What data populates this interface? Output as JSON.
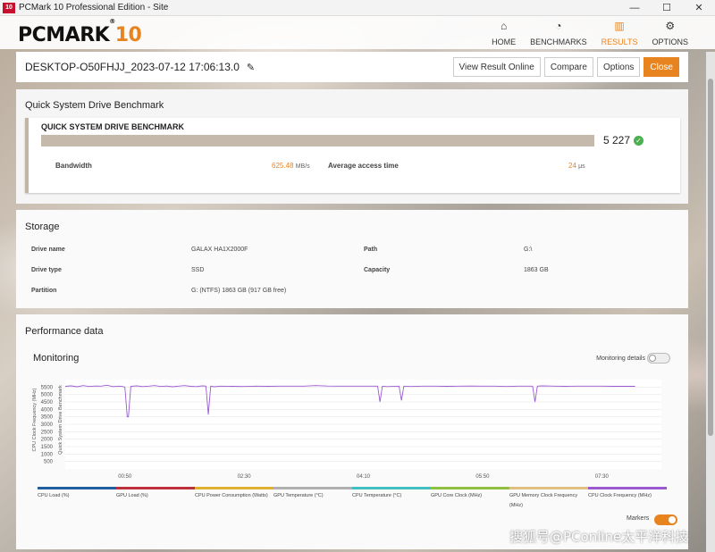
{
  "window": {
    "title": "PCMark 10 Professional Edition - Site",
    "app_icon": "10",
    "controls": [
      "—",
      "☐",
      "✕"
    ]
  },
  "header": {
    "logo_main": "PCMARK",
    "logo_num": "10",
    "logo_reg": "®",
    "nav": [
      {
        "label": "HOME",
        "icon": "home-icon",
        "glyph": "⌂",
        "active": false
      },
      {
        "label": "BENCHMARKS",
        "icon": "gauge-icon",
        "glyph": "◔",
        "active": false
      },
      {
        "label": "RESULTS",
        "icon": "bar-chart-icon",
        "glyph": "▥",
        "active": true
      },
      {
        "label": "OPTIONS",
        "icon": "gear-icon",
        "glyph": "⚙",
        "active": false
      }
    ]
  },
  "result": {
    "name": "DESKTOP-O50FHJJ_2023-07-12 17:06:13.0",
    "edit_icon": "pencil-icon",
    "buttons": {
      "view_online": "View Result Online",
      "compare": "Compare",
      "options": "Options",
      "close": "Close"
    }
  },
  "benchmark": {
    "section_title": "Quick System Drive Benchmark",
    "card_title": "QUICK SYSTEM DRIVE BENCHMARK",
    "score": "5 227",
    "bandwidth_label": "Bandwidth",
    "bandwidth_value": "625.48",
    "bandwidth_unit": "MB/s",
    "access_label": "Average access time",
    "access_value": "24",
    "access_unit": "μs"
  },
  "storage": {
    "section_title": "Storage",
    "drive_name_label": "Drive name",
    "drive_name": "GALAX HA1X2000F",
    "drive_type_label": "Drive type",
    "drive_type": "SSD",
    "partition_label": "Partition",
    "partition": "G: (NTFS) 1863 GB (917 GB free)",
    "path_label": "Path",
    "path": "G:\\",
    "capacity_label": "Capacity",
    "capacity": "1863 GB"
  },
  "performance": {
    "section_title": "Performance data",
    "monitoring_title": "Monitoring",
    "monitoring_details_label": "Monitoring details",
    "monitoring_details_on": false,
    "markers_label": "Markers",
    "markers_on": true
  },
  "chart_data": {
    "type": "line",
    "ylabel_outer": "CPU Clock Frequency (MHz)",
    "ylabel_inner": "Quick System Drive Benchmark",
    "y_ticks": [
      500,
      1000,
      1500,
      2000,
      2500,
      3000,
      3500,
      4000,
      4500,
      5000,
      5500
    ],
    "ylim": [
      0,
      6000
    ],
    "x_ticks": [
      "00:50",
      "02:30",
      "04:10",
      "05:50",
      "07:30"
    ],
    "x_tick_seconds": [
      50,
      150,
      250,
      350,
      450
    ],
    "xlim": [
      0,
      500
    ],
    "series": [
      {
        "name": "CPU Clock Frequency (MHz)",
        "color": "#9b59d0",
        "points": [
          [
            0,
            5550
          ],
          [
            5,
            5580
          ],
          [
            10,
            5520
          ],
          [
            15,
            5600
          ],
          [
            20,
            5540
          ],
          [
            25,
            5570
          ],
          [
            30,
            5560
          ],
          [
            35,
            5620
          ],
          [
            40,
            5530
          ],
          [
            45,
            5560
          ],
          [
            48,
            5540
          ],
          [
            50,
            5500
          ],
          [
            52,
            3500
          ],
          [
            53,
            3500
          ],
          [
            55,
            5550
          ],
          [
            60,
            5580
          ],
          [
            65,
            5530
          ],
          [
            70,
            5560
          ],
          [
            75,
            5600
          ],
          [
            80,
            5540
          ],
          [
            85,
            5570
          ],
          [
            90,
            5520
          ],
          [
            95,
            5560
          ],
          [
            100,
            5600
          ],
          [
            105,
            5550
          ],
          [
            110,
            5530
          ],
          [
            115,
            5580
          ],
          [
            118,
            5560
          ],
          [
            120,
            3650
          ],
          [
            122,
            5560
          ],
          [
            125,
            5520
          ],
          [
            130,
            5560
          ],
          [
            140,
            5550
          ],
          [
            150,
            5540
          ],
          [
            160,
            5560
          ],
          [
            170,
            5550
          ],
          [
            180,
            5560
          ],
          [
            190,
            5560
          ],
          [
            200,
            5560
          ],
          [
            210,
            5600
          ],
          [
            220,
            5570
          ],
          [
            230,
            5560
          ],
          [
            240,
            5560
          ],
          [
            250,
            5560
          ],
          [
            262,
            5560
          ],
          [
            264,
            4500
          ],
          [
            266,
            5560
          ],
          [
            270,
            5530
          ],
          [
            280,
            5560
          ],
          [
            282,
            4600
          ],
          [
            284,
            5560
          ],
          [
            290,
            5540
          ],
          [
            300,
            5560
          ],
          [
            310,
            5560
          ],
          [
            320,
            5550
          ],
          [
            330,
            5560
          ],
          [
            340,
            5570
          ],
          [
            350,
            5560
          ],
          [
            360,
            5560
          ],
          [
            370,
            5540
          ],
          [
            380,
            5560
          ],
          [
            392,
            5560
          ],
          [
            394,
            4500
          ],
          [
            396,
            5560
          ],
          [
            400,
            5580
          ],
          [
            410,
            5560
          ],
          [
            420,
            5550
          ],
          [
            430,
            5560
          ],
          [
            440,
            5560
          ],
          [
            450,
            5560
          ],
          [
            460,
            5550
          ],
          [
            470,
            5550
          ],
          [
            478,
            5550
          ]
        ]
      }
    ],
    "legend": [
      {
        "name": "CPU Load (%)",
        "color": "#1f5fa0"
      },
      {
        "name": "GPU Load (%)",
        "color": "#c0303a"
      },
      {
        "name": "CPU Power Consumption (Watts)",
        "color": "#e0b030"
      },
      {
        "name": "GPU Temperature (°C)",
        "color": "#b0b0b0"
      },
      {
        "name": "CPU Temperature (°C)",
        "color": "#40c0c0"
      },
      {
        "name": "GPU Core Clock (MHz)",
        "color": "#90c040"
      },
      {
        "name": "GPU Memory Clock Frequency (MHz)",
        "color": "#e0c080"
      },
      {
        "name": "CPU Clock Frequency (MHz)",
        "color": "#9b59d0"
      }
    ]
  },
  "watermark": "搜狐号@PConline太平洋科技"
}
